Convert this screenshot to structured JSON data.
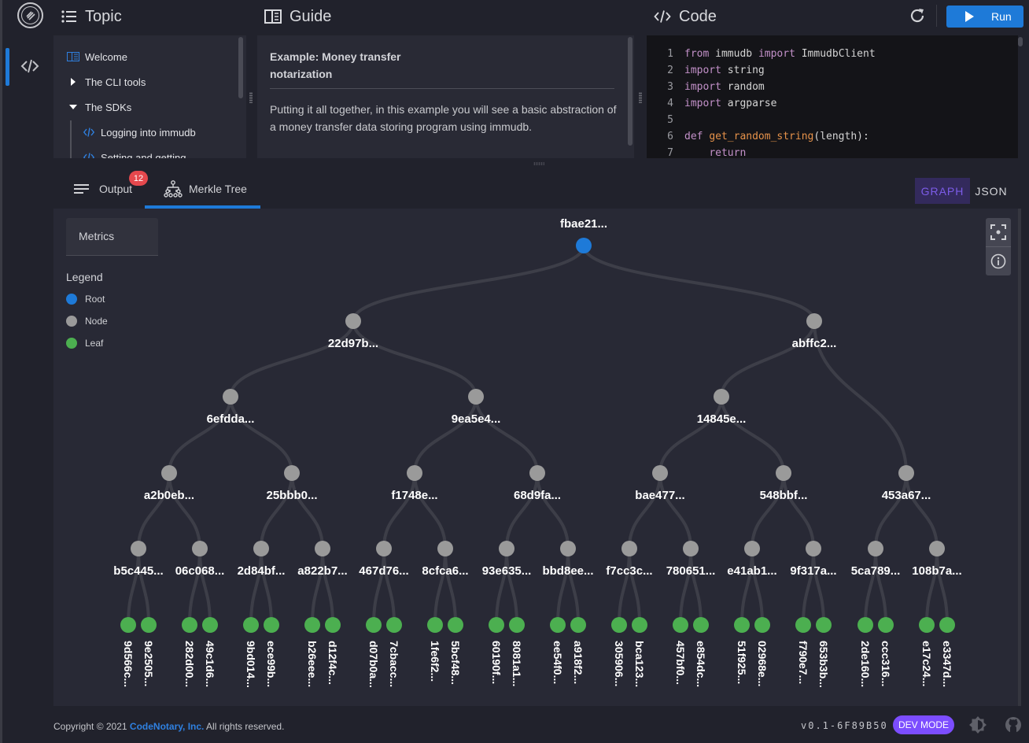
{
  "rail": {
    "logo": "immudb-logo",
    "items": [
      {
        "icon": "code-icon",
        "active": true
      }
    ]
  },
  "topic": {
    "title": "Topic",
    "items": [
      {
        "label": "Welcome",
        "icon": "book-icon"
      },
      {
        "label": "The CLI tools",
        "icon": "caret-right-icon",
        "expanded": false
      },
      {
        "label": "The SDKs",
        "icon": "caret-down-icon",
        "expanded": true
      },
      {
        "label": "Logging into immudb",
        "icon": "code-icon",
        "child": true
      },
      {
        "label": "Setting and getting",
        "icon": "code-icon",
        "child": true
      }
    ]
  },
  "guide": {
    "title": "Guide",
    "heading_line1": "Example: Money transfer",
    "heading_line2": "notarization",
    "body": "Putting it all together, in this example you will see a basic abstraction of a money transfer data storing program using immudb."
  },
  "code": {
    "title": "Code",
    "run_label": "Run",
    "lines": [
      {
        "n": "1",
        "tokens": [
          [
            "kw",
            "from"
          ],
          [
            "tx",
            " immudb "
          ],
          [
            "kw",
            "import"
          ],
          [
            "tx",
            " ImmudbClient"
          ]
        ]
      },
      {
        "n": "2",
        "tokens": [
          [
            "kw",
            "import"
          ],
          [
            "tx",
            " string"
          ]
        ]
      },
      {
        "n": "3",
        "tokens": [
          [
            "kw",
            "import"
          ],
          [
            "tx",
            " random"
          ]
        ]
      },
      {
        "n": "4",
        "tokens": [
          [
            "kw",
            "import"
          ],
          [
            "tx",
            " argparse"
          ]
        ]
      },
      {
        "n": "5",
        "tokens": []
      },
      {
        "n": "6",
        "tokens": [
          [
            "kw",
            "def"
          ],
          [
            "tx",
            " "
          ],
          [
            "fn",
            "get_random_string"
          ],
          [
            "tx",
            "(length):"
          ]
        ]
      },
      {
        "n": "7",
        "tokens": [
          [
            "tx",
            "    "
          ],
          [
            "kw",
            "return"
          ]
        ]
      }
    ]
  },
  "tabs": {
    "output_label": "Output",
    "output_badge": "12",
    "merkle_label": "Merkle Tree",
    "active": "merkle",
    "graph_label": "GRAPH",
    "json_label": "JSON",
    "view_active": "graph"
  },
  "panel": {
    "metrics_label": "Metrics",
    "legend_title": "Legend",
    "legend": [
      {
        "label": "Root",
        "color": "#1e7ad8"
      },
      {
        "label": "Node",
        "color": "#9a9a9a"
      },
      {
        "label": "Leaf",
        "color": "#4caf50"
      }
    ]
  },
  "tree": {
    "colors": {
      "root": "#1e7ad8",
      "node": "#9a9a9a",
      "leaf": "#4caf50",
      "edge": "#3d3e48"
    },
    "root": "fbae21...",
    "level1": [
      "22d97b...",
      "abffc2..."
    ],
    "level2": [
      "6efdda...",
      "9ea5e4...",
      "14845e..."
    ],
    "level3": [
      "a2b0eb...",
      "25bbb0...",
      "f1748e...",
      "68d9fa...",
      "bae477...",
      "548bbf...",
      "453a67..."
    ],
    "level4": [
      "b5c445...",
      "06c068...",
      "2d84bf...",
      "a822b7...",
      "467d76...",
      "8cfca6...",
      "93e635...",
      "bbd8ee...",
      "f7cc3c...",
      "780651...",
      "e41ab1...",
      "9f317a...",
      "5ca789...",
      "108b7a..."
    ],
    "leaves": [
      "9d566c...",
      "9e2505...",
      "282d00...",
      "49c1d6...",
      "9bd014...",
      "ece99b...",
      "b26eee...",
      "d12f4c...",
      "d07b0a...",
      "7cbacc...",
      "1fe6f2...",
      "5bcf48...",
      "60190f...",
      "8081a1...",
      "ee54f0...",
      "a918f2...",
      "305906...",
      "bca123...",
      "457bf0...",
      "e854dc...",
      "51f925...",
      "02968e...",
      "f790e7...",
      "653b3b...",
      "2de160...",
      "ccc316...",
      "e17c24...",
      "e3347d..."
    ]
  },
  "footer": {
    "copyright_prefix": "Copyright © 2021 ",
    "company": "CodeNotary, Inc.",
    "copyright_suffix": " All rights reserved.",
    "version": "v0.1-6F89B50",
    "dev_mode": "DEV MODE"
  }
}
